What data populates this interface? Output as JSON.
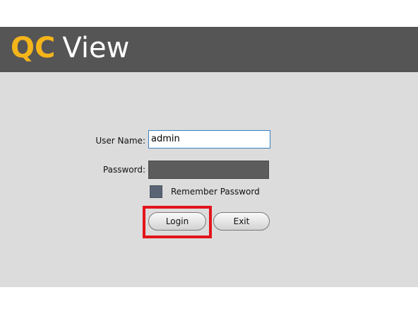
{
  "app": {
    "title_part1": "QC",
    "title_part2": "View"
  },
  "form": {
    "username_label": "User Name:",
    "username_value": "admin",
    "password_label": "Password:",
    "password_value": "",
    "remember_label": "Remember Password",
    "remember_checked": false,
    "login_label": "Login",
    "exit_label": "Exit"
  },
  "colors": {
    "header_bg": "#555555",
    "logo_accent": "#f4b51b",
    "body_bg": "#dcdcdc",
    "highlight": "#e3141b"
  }
}
